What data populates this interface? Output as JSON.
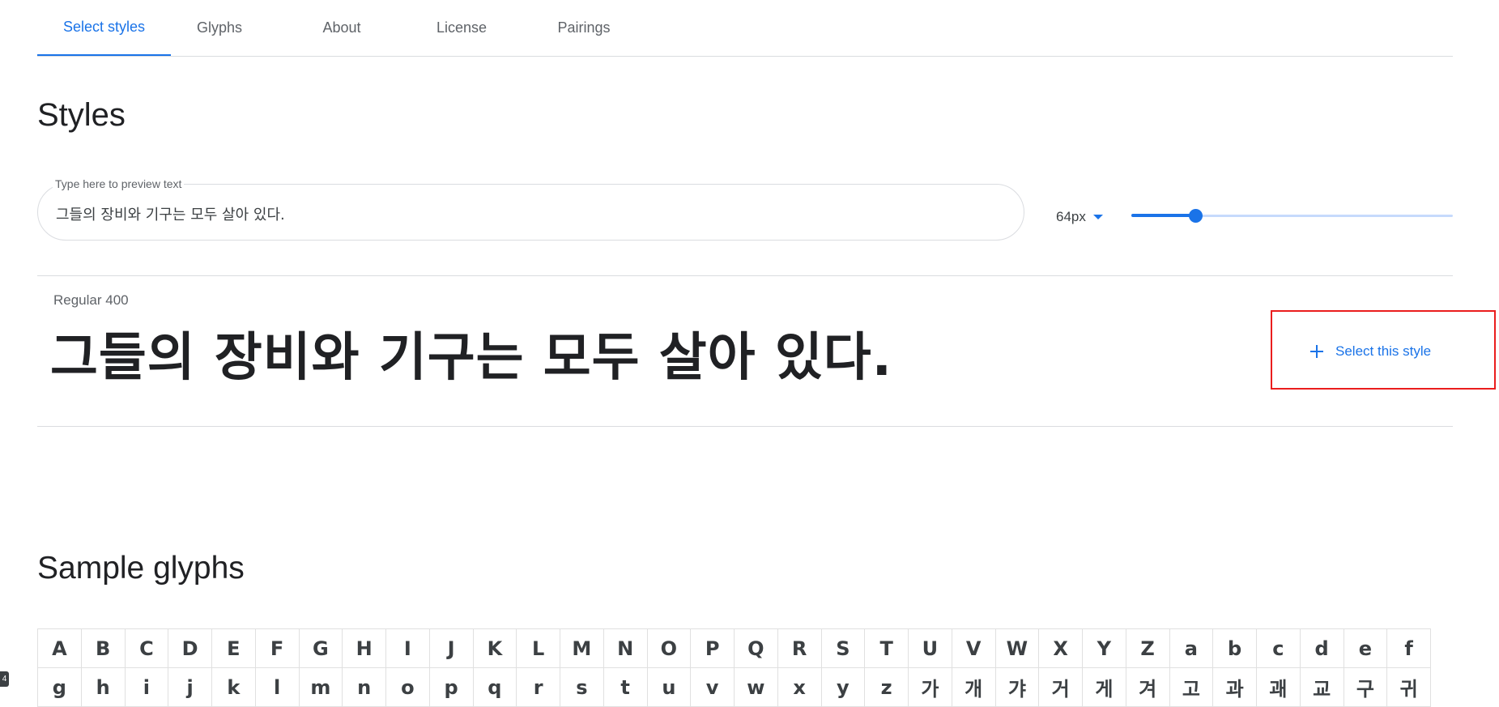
{
  "tabs": [
    {
      "label": "Select styles",
      "active": true
    },
    {
      "label": "Glyphs",
      "active": false
    },
    {
      "label": "About",
      "active": false
    },
    {
      "label": "License",
      "active": false
    },
    {
      "label": "Pairings",
      "active": false
    }
  ],
  "styles_section": {
    "title": "Styles",
    "preview": {
      "legend": "Type here to preview text",
      "value": "그들의 장비와 기구는 모두 살아 있다."
    },
    "font_size": {
      "value": "64px",
      "slider_fraction": 0.2
    },
    "style_row": {
      "name": "Regular 400",
      "preview_text": "그들의 장비와 기구는 모두 살아 있다.",
      "select_label": "Select this style"
    }
  },
  "glyphs_section": {
    "title": "Sample glyphs",
    "row1": [
      "A",
      "B",
      "C",
      "D",
      "E",
      "F",
      "G",
      "H",
      "I",
      "J",
      "K",
      "L",
      "M",
      "N",
      "O",
      "P",
      "Q",
      "R",
      "S",
      "T",
      "U",
      "V",
      "W",
      "X",
      "Y",
      "Z",
      "a",
      "b",
      "c",
      "d",
      "e",
      "f"
    ],
    "row2": [
      "g",
      "h",
      "i",
      "j",
      "k",
      "l",
      "m",
      "n",
      "o",
      "p",
      "q",
      "r",
      "s",
      "t",
      "u",
      "v",
      "w",
      "x",
      "y",
      "z",
      "가",
      "개",
      "갸",
      "거",
      "게",
      "겨",
      "고",
      "과",
      "괘",
      "교",
      "구",
      "귀"
    ]
  },
  "corner_badge": "4",
  "colors": {
    "accent": "#1a73e8",
    "highlight_box": "#ea1d1d",
    "divider": "#dadce0",
    "text": "#202124"
  }
}
